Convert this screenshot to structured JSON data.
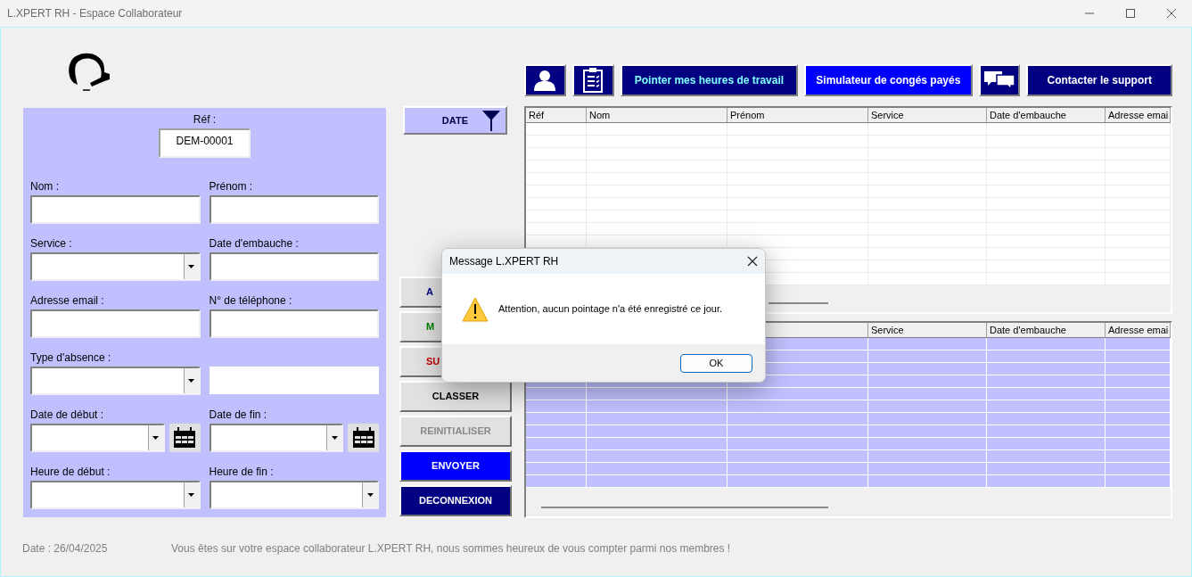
{
  "window": {
    "title": "L.XPERT RH - Espace Collaborateur"
  },
  "form": {
    "ref_label": "Réf :",
    "ref_value": "DEM-00001",
    "fields": [
      {
        "label": "Nom :",
        "kind": "text"
      },
      {
        "label": "Prénom :",
        "kind": "text"
      },
      {
        "label": "Service :",
        "kind": "combo"
      },
      {
        "label": "Date d'embauche :",
        "kind": "text"
      },
      {
        "label": "Adresse email :",
        "kind": "text"
      },
      {
        "label": "N° de téléphone :",
        "kind": "text"
      },
      {
        "label": "Type d'absence :",
        "kind": "combo"
      },
      {
        "kind": "plain"
      },
      {
        "label": "Date de début :",
        "kind": "date"
      },
      {
        "label": "Date de fin :",
        "kind": "date"
      },
      {
        "label": "Heure de début :",
        "kind": "combo"
      },
      {
        "label": "Heure de fin :",
        "kind": "combo"
      }
    ]
  },
  "filter_button": {
    "label": "DATE"
  },
  "side_buttons": [
    {
      "label": "A",
      "kind": "plain",
      "color": "#000080",
      "covered": true,
      "disabled": false
    },
    {
      "label": "M",
      "kind": "plain",
      "color": "#008000",
      "covered": true,
      "disabled": false
    },
    {
      "label": "SU",
      "kind": "plain",
      "color": "#c00000",
      "covered": true,
      "disabled": false
    },
    {
      "label": "CLASSER",
      "kind": "plain",
      "color": "#000000",
      "covered": false,
      "disabled": false
    },
    {
      "label": "REINITIALISER",
      "kind": "plain",
      "covered": false,
      "disabled": true
    },
    {
      "label": "ENVOYER",
      "kind": "blue",
      "covered": false,
      "disabled": false
    },
    {
      "label": "DECONNEXION",
      "kind": "navy",
      "covered": false,
      "disabled": false
    }
  ],
  "toolbar": [
    {
      "kind": "person"
    },
    {
      "kind": "clipboard"
    },
    {
      "kind": "text",
      "label": "Pointer mes heures de travail",
      "highlight": true,
      "selected": false
    },
    {
      "kind": "text",
      "label": "Simulateur de congés payés",
      "highlight": false,
      "selected": true
    },
    {
      "kind": "chat"
    },
    {
      "kind": "text",
      "label": "Contacter le support",
      "highlight": false,
      "selected": false
    }
  ],
  "upper_table": {
    "columns": [
      "Réf",
      "Nom",
      "Prénom",
      "Service",
      "Date d'embauche",
      "Adresse emai"
    ]
  },
  "lower_table": {
    "columns": [
      "Service",
      "Date d'embauche",
      "Adresse emai"
    ]
  },
  "status": {
    "date": "Date : 26/04/2025",
    "message": "Vous êtes sur votre espace collaborateur L.XPERT RH, nous sommes heureux de vous compter parmi nos membres !"
  },
  "dialog": {
    "title": "Message L.XPERT RH",
    "message": "Attention, aucun pointage n'a été enregistré ce jour.",
    "button": "OK"
  }
}
